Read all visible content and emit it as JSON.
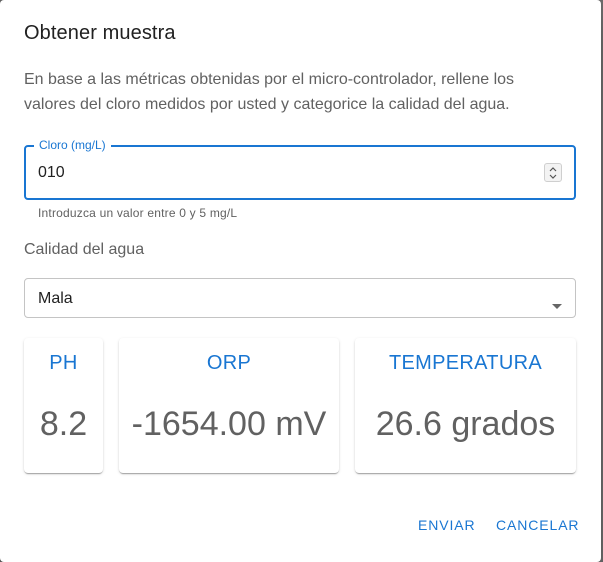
{
  "dialog": {
    "title": "Obtener muestra",
    "description": "En base a las métricas obtenidas por el micro-controlador, rellene los valores del cloro medidos por usted y categorice la calidad del agua."
  },
  "chlorine_field": {
    "label": "Cloro (mg/L)",
    "value": "010",
    "helper": "Introduzca un valor entre 0 y 5 mg/L"
  },
  "quality": {
    "label": "Calidad del agua",
    "selected": "Mala"
  },
  "metrics": [
    {
      "title": "PH",
      "value": "8.2"
    },
    {
      "title": "ORP",
      "value": "-1654.00 mV"
    },
    {
      "title": "TEMPERATURA",
      "value": "26.6 grados"
    }
  ],
  "actions": {
    "submit_label": "ENVIAR",
    "cancel_label": "CANCELAR"
  },
  "colors": {
    "accent": "#1976d2",
    "text_secondary": "#616161"
  },
  "icons": {
    "spinner": "up-down-arrows-icon",
    "select": "dropdown-caret-icon"
  }
}
